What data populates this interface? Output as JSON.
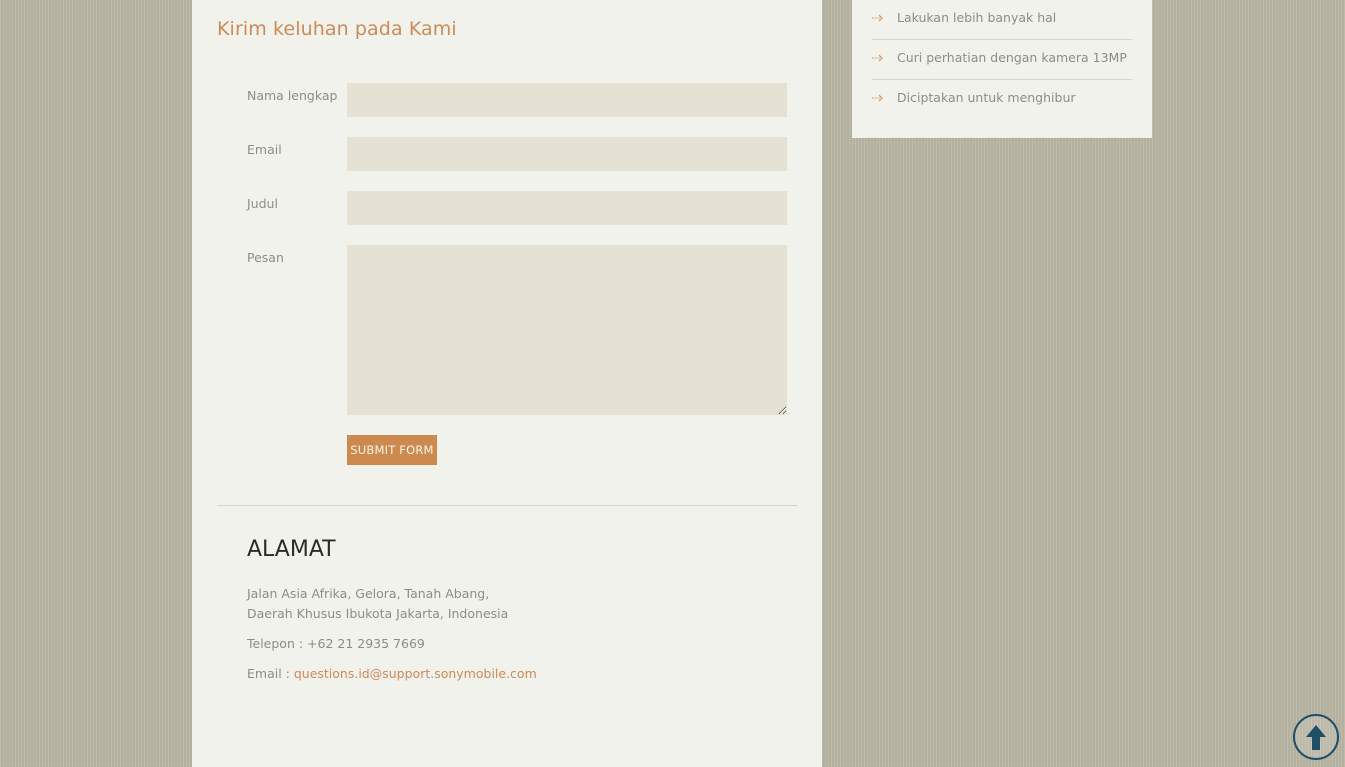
{
  "contact_form": {
    "heading": "Kirim keluhan pada Kami",
    "fields": {
      "full_name": {
        "label": "Nama lengkap",
        "value": ""
      },
      "email": {
        "label": "Email",
        "value": ""
      },
      "subject": {
        "label": "Judul",
        "value": ""
      },
      "message": {
        "label": "Pesan",
        "value": ""
      }
    },
    "submit_label": "SUBMIT FORM"
  },
  "address": {
    "heading": "ALAMAT",
    "line1": "Jalan Asia Afrika, Gelora, Tanah Abang,",
    "line2": "Daerah Khusus Ibukota Jakarta, Indonesia",
    "phone": "Telepon : +62 21 2935 7669",
    "email_label": "Email : ",
    "email_value": "questions.id@support.sonymobile.com"
  },
  "sidebar": {
    "items": [
      {
        "label": "Lakukan lebih banyak hal",
        "icon": "arrow-right-icon"
      },
      {
        "label": "Curi perhatian dengan kamera 13MP",
        "icon": "arrow-right-icon"
      },
      {
        "label": "Diciptakan untuk menghibur",
        "icon": "arrow-right-icon"
      }
    ]
  },
  "back_to_top": {
    "icon": "arrow-up-icon"
  },
  "colors": {
    "accent": "#cd8a56",
    "background": "#bcb8a6",
    "panel": "#f2f2ed",
    "field": "#e5e2d4",
    "back_to_top": "#1f4f66"
  }
}
